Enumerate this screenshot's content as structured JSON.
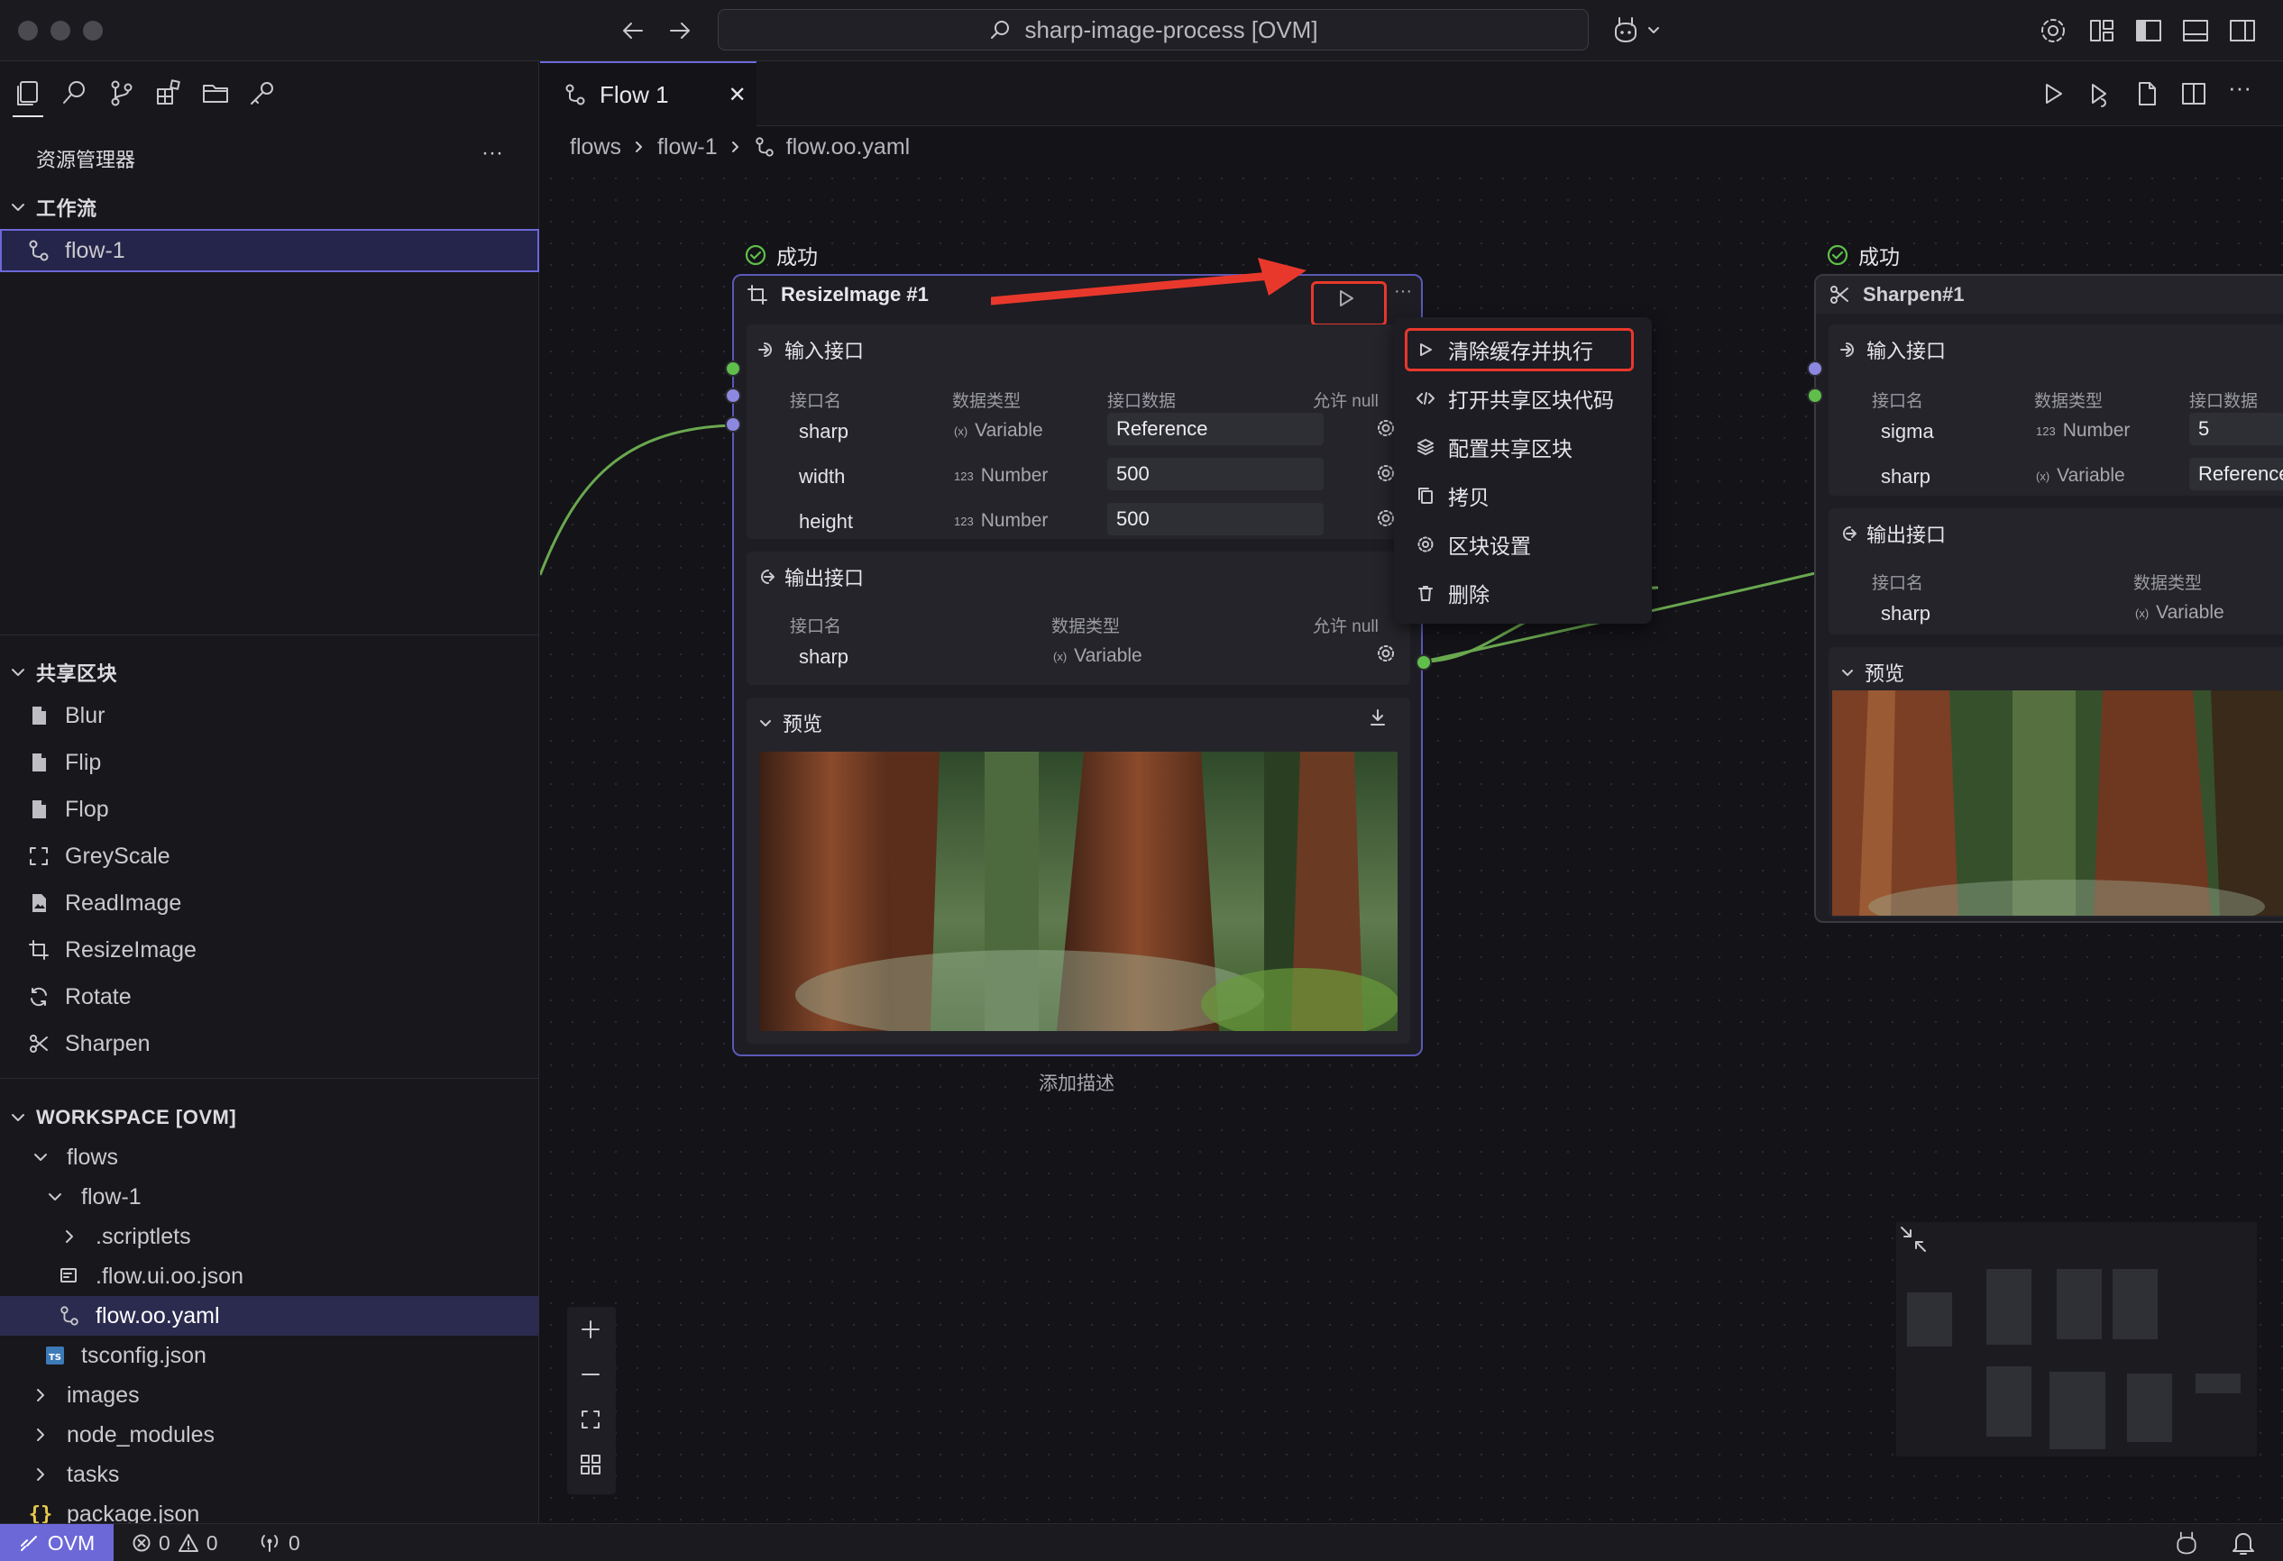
{
  "titlebar": {
    "command_center": "sharp-image-process [OVM]"
  },
  "sidebar": {
    "title": "资源管理器",
    "more": "···",
    "workflow_section": "工作流",
    "workflow_items": [
      "flow-1"
    ],
    "shared_section": "共享区块",
    "shared_items": [
      {
        "label": "Blur",
        "icon": "file-icon"
      },
      {
        "label": "Flip",
        "icon": "file-icon"
      },
      {
        "label": "Flop",
        "icon": "file-icon"
      },
      {
        "label": "GreyScale",
        "icon": "fullscreen-icon"
      },
      {
        "label": "ReadImage",
        "icon": "file-image-icon"
      },
      {
        "label": "ResizeImage",
        "icon": "crop-icon"
      },
      {
        "label": "Rotate",
        "icon": "rotate-icon"
      },
      {
        "label": "Sharpen",
        "icon": "scissors-icon"
      }
    ],
    "workspace_section": "WORKSPACE [OVM]",
    "tree": [
      {
        "label": "flows",
        "depth": 1,
        "type": "folder-open"
      },
      {
        "label": "flow-1",
        "depth": 2,
        "type": "folder-open"
      },
      {
        "label": ".scriptlets",
        "depth": 3,
        "type": "folder"
      },
      {
        "label": ".flow.ui.oo.json",
        "depth": 3,
        "type": "file"
      },
      {
        "label": "flow.oo.yaml",
        "depth": 3,
        "type": "flow",
        "selected": true
      },
      {
        "label": "tsconfig.json",
        "depth": 2,
        "type": "ts"
      },
      {
        "label": "images",
        "depth": 1,
        "type": "folder"
      },
      {
        "label": "node_modules",
        "depth": 1,
        "type": "folder"
      },
      {
        "label": "tasks",
        "depth": 1,
        "type": "folder"
      },
      {
        "label": "package.json",
        "depth": 1,
        "type": "json"
      }
    ]
  },
  "editor": {
    "tab": {
      "label": "Flow 1",
      "close": "✕"
    },
    "breadcrumbs": [
      "flows",
      "flow-1",
      "flow.oo.yaml"
    ]
  },
  "node1": {
    "status": "成功",
    "title": "ResizeImage #1",
    "inputs_title": "输入接口",
    "col_name": "接口名",
    "col_type": "数据类型",
    "col_value": "接口数据",
    "col_null": "允许 null",
    "inputs": [
      {
        "name": "sharp",
        "type": "Variable",
        "type_icon": "(x)",
        "value": "Reference"
      },
      {
        "name": "width",
        "type": "Number",
        "type_icon": "123",
        "value": "500"
      },
      {
        "name": "height",
        "type": "Number",
        "type_icon": "123",
        "value": "500"
      }
    ],
    "outputs_title": "输出接口",
    "outputs": [
      {
        "name": "sharp",
        "type": "Variable",
        "type_icon": "(x)"
      }
    ],
    "preview_title": "预览",
    "add_desc": "添加描述"
  },
  "node2": {
    "status": "成功",
    "title": "Sharpen#1",
    "inputs_title": "输入接口",
    "col_name": "接口名",
    "col_type": "数据类型",
    "col_value": "接口数据",
    "inputs": [
      {
        "name": "sigma",
        "type": "Number",
        "type_icon": "123",
        "value": "5"
      },
      {
        "name": "sharp",
        "type": "Variable",
        "type_icon": "(x)",
        "value": "Reference"
      }
    ],
    "outputs_title": "输出接口",
    "outputs": [
      {
        "name": "sharp",
        "type": "Variable",
        "type_icon": "(x)"
      }
    ],
    "preview_title": "预览"
  },
  "context_menu": [
    {
      "label": "清除缓存并执行",
      "icon": "play-icon",
      "highlighted": true
    },
    {
      "label": "打开共享区块代码",
      "icon": "code-icon"
    },
    {
      "label": "配置共享区块",
      "icon": "layers-icon"
    },
    {
      "label": "拷贝",
      "icon": "copy-icon"
    },
    {
      "label": "区块设置",
      "icon": "gear-icon"
    },
    {
      "label": "删除",
      "icon": "trash-icon"
    }
  ],
  "statusbar": {
    "remote": "OVM",
    "errors": "0",
    "warnings": "0",
    "ports": "0"
  },
  "colors": {
    "accent": "#6c68d8",
    "success": "#5fbf4a",
    "annotation": "#e8382c",
    "edge": "#6aa84f"
  }
}
